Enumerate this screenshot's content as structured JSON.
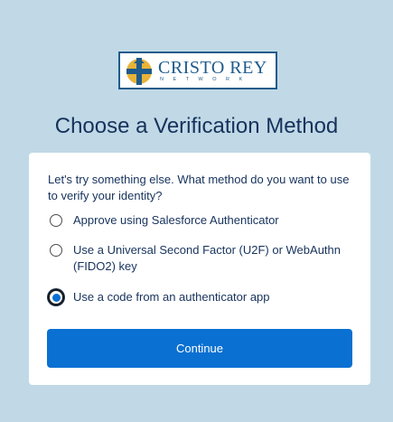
{
  "logo": {
    "name": "CRISTO REY",
    "subtitle": "NETWORK",
    "icon": "cristo-rey-cross-logo",
    "colors": {
      "blue": "#1f5b8c",
      "gold": "#e8b338"
    }
  },
  "page_title": "Choose a Verification Method",
  "prompt": "Let's try something else. What method do you want to use to verify your identity?",
  "options": [
    {
      "label": "Approve using Salesforce Authenticator",
      "checked": false
    },
    {
      "label": "Use a Universal Second Factor (U2F) or WebAuthn (FIDO2) key",
      "checked": false
    },
    {
      "label": "Use a code from an authenticator app",
      "checked": true
    }
  ],
  "continue_label": "Continue",
  "colors": {
    "background": "#c1d9e6",
    "primary": "#0a70d2",
    "text": "#16325c"
  }
}
